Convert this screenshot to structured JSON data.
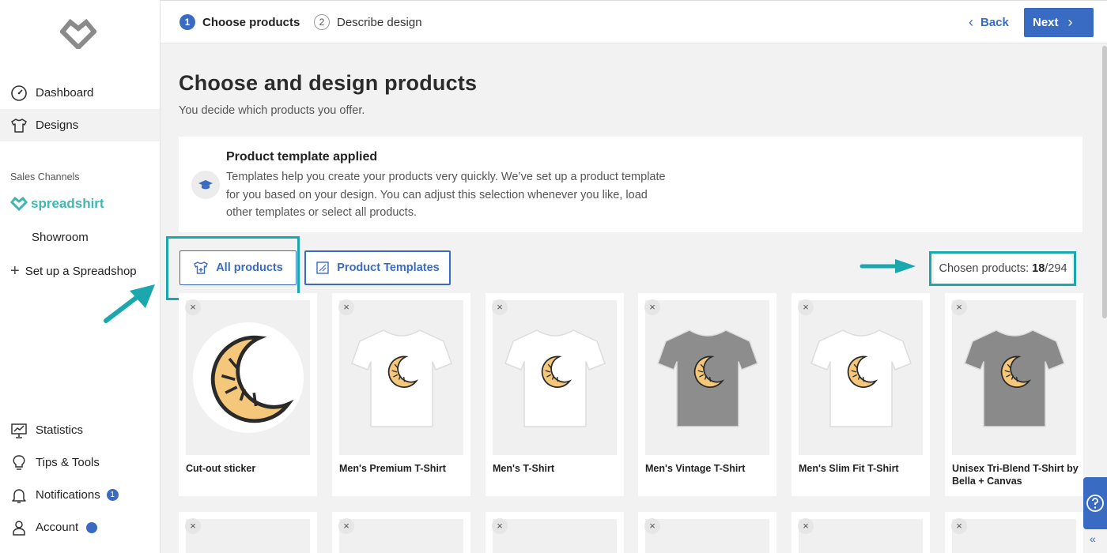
{
  "sidebar": {
    "nav_top": [
      {
        "label": "Dashboard",
        "icon": "gauge-icon"
      },
      {
        "label": "Designs",
        "icon": "shirt-icon",
        "active": true
      }
    ],
    "sales_channels_label": "Sales Channels",
    "brand_name": "spreadshirt",
    "showroom_label": "Showroom",
    "setup_label": "Set up a Spreadshop",
    "nav_bottom": [
      {
        "label": "Statistics",
        "icon": "chart-icon"
      },
      {
        "label": "Tips & Tools",
        "icon": "lightbulb-icon"
      },
      {
        "label": "Notifications",
        "icon": "bell-icon",
        "badge": "1"
      },
      {
        "label": "Account",
        "icon": "user-icon"
      }
    ]
  },
  "header": {
    "steps": [
      {
        "num": "1",
        "label": "Choose products"
      },
      {
        "num": "2",
        "label": "Describe design"
      }
    ],
    "back_label": "Back",
    "next_label": "Next"
  },
  "main": {
    "title": "Choose and design products",
    "subtitle": "You decide which products you offer.",
    "info_title": "Product template applied",
    "info_text": "Templates help you create your products very quickly. We’ve set up a product template for you based on your design. You can adjust this selection whenever you like, load other templates or select all products.",
    "tabs": [
      {
        "label": "All products"
      },
      {
        "label": "Product Templates"
      }
    ],
    "chosen_label": "Chosen products: ",
    "chosen_count": "18",
    "chosen_total": "/294",
    "products": [
      {
        "name": "Cut-out sticker",
        "kind": "sticker",
        "color": "#ffffff"
      },
      {
        "name": "Men's Premium T-Shirt",
        "kind": "shirt",
        "color": "#ffffff"
      },
      {
        "name": "Men's T-Shirt",
        "kind": "shirt",
        "color": "#ffffff"
      },
      {
        "name": "Men's Vintage T-Shirt",
        "kind": "shirt",
        "color": "#8d8d8d"
      },
      {
        "name": "Men's Slim Fit T-Shirt",
        "kind": "shirt",
        "color": "#ffffff"
      },
      {
        "name": "Unisex Tri-Blend T-Shirt by Bella + Canvas",
        "kind": "shirt",
        "color": "#8a8a8a"
      }
    ]
  },
  "colors": {
    "accent": "#3a6bc2",
    "highlight": "#1aa7ae",
    "brand": "#3fb6b0",
    "moon": "#f4c77a"
  }
}
